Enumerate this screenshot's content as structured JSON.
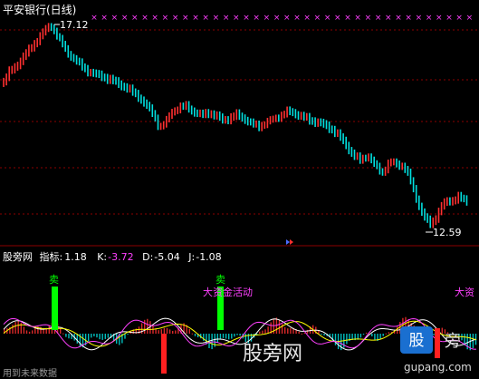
{
  "header": {
    "title": "平安银行(日线)"
  },
  "price_panel": {
    "high_label": "17.12",
    "low_label": "12.59"
  },
  "indicator_panel": {
    "name": "股旁网",
    "metric_label": "指标:",
    "metric_value": "1.18",
    "k_label": "K:",
    "k_value": "-3.72",
    "d_label": "D:",
    "d_value": "-5.04",
    "j_label": "J:",
    "j_value": "-1.08"
  },
  "signals": {
    "sell_1": "卖",
    "sell_2": "卖",
    "money_1": "大资金活动",
    "money_2": "大资"
  },
  "footer": {
    "note": "用到未来数据"
  },
  "watermark": {
    "text": "股旁网",
    "site": "gupang.com"
  },
  "colors": {
    "up": "#ff3030",
    "down": "#00e0e0",
    "sell_bar": "#00ff00",
    "buy_bar": "#ff2020",
    "marker": "#ff40ff",
    "money_text": "#ff40ff",
    "sell_text": "#00ff00",
    "k_line": "#ffffff",
    "d_line": "#ffff00",
    "j_line": "#ff40ff",
    "divider": "#8b0000"
  },
  "icons": {
    "scroll": "double-chevron-right-icon",
    "logo": "brand-logo-icon"
  }
}
